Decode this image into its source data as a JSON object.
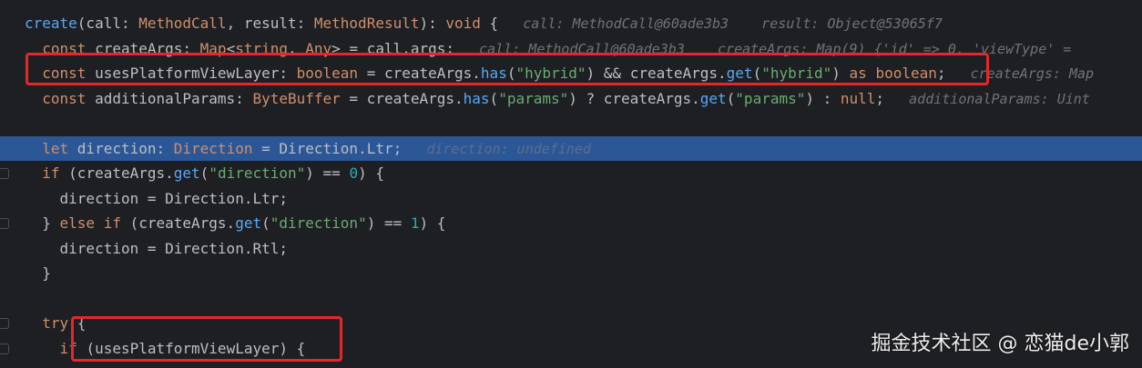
{
  "editor": {
    "lines": [
      {
        "t": [
          [
            "create",
            "fn"
          ],
          [
            "(call: ",
            "pl"
          ],
          [
            "MethodCall",
            "ty"
          ],
          [
            ", result: ",
            "pl"
          ],
          [
            "MethodResult",
            "ty"
          ],
          [
            "): ",
            "pl"
          ],
          [
            "void",
            "kw"
          ],
          [
            " {",
            "pl"
          ],
          [
            "   call: MethodCall@60ade3b3    result: Object@53065f7",
            "hint"
          ]
        ]
      },
      {
        "t": [
          [
            "  const ",
            "kw"
          ],
          [
            "createArgs: ",
            "pl"
          ],
          [
            "Map",
            "ty"
          ],
          [
            "<",
            "pl"
          ],
          [
            "string",
            "kw"
          ],
          [
            ", ",
            "pl"
          ],
          [
            "Any",
            "ty"
          ],
          [
            "> = call.args;",
            "pl"
          ],
          [
            "   call: MethodCall@60ade3b3    createArgs: Map(9) {'id' => 0, 'viewType' =",
            "hint"
          ]
        ]
      },
      {
        "t": [
          [
            "  const ",
            "kw"
          ],
          [
            "usesPlatformViewLayer: ",
            "pl"
          ],
          [
            "boolean",
            "kw"
          ],
          [
            " = createArgs.",
            "pl"
          ],
          [
            "has",
            "fn"
          ],
          [
            "(",
            "pl"
          ],
          [
            "\"hybrid\"",
            "str"
          ],
          [
            ") && createArgs.",
            "pl"
          ],
          [
            "get",
            "fn"
          ],
          [
            "(",
            "pl"
          ],
          [
            "\"hybrid\"",
            "str"
          ],
          [
            ") ",
            "pl"
          ],
          [
            "as",
            "kw"
          ],
          [
            " ",
            "pl"
          ],
          [
            "boolean",
            "kw"
          ],
          [
            ";",
            "pl"
          ],
          [
            "   createArgs: Map",
            "hint"
          ]
        ]
      },
      {
        "t": [
          [
            "  const ",
            "kw"
          ],
          [
            "additionalParams: ",
            "pl"
          ],
          [
            "ByteBuffer",
            "ty"
          ],
          [
            " = createArgs.",
            "pl"
          ],
          [
            "has",
            "fn"
          ],
          [
            "(",
            "pl"
          ],
          [
            "\"params\"",
            "str"
          ],
          [
            ") ? createArgs.",
            "pl"
          ],
          [
            "get",
            "fn"
          ],
          [
            "(",
            "pl"
          ],
          [
            "\"params\"",
            "str"
          ],
          [
            ") : ",
            "pl"
          ],
          [
            "null",
            "kw"
          ],
          [
            ";",
            "pl"
          ],
          [
            "   additionalParams: Uint",
            "hint"
          ]
        ]
      },
      {
        "t": []
      },
      {
        "current": true,
        "t": [
          [
            "  let ",
            "kw"
          ],
          [
            "direction: ",
            "pl"
          ],
          [
            "Direction",
            "ty"
          ],
          [
            " = Direction.Ltr;",
            "pl"
          ],
          [
            "   direction: undefined",
            "hint-cur"
          ]
        ]
      },
      {
        "t": [
          [
            "  if ",
            "kw"
          ],
          [
            "(createArgs.",
            "pl"
          ],
          [
            "get",
            "fn"
          ],
          [
            "(",
            "pl"
          ],
          [
            "\"direction\"",
            "str"
          ],
          [
            ") == ",
            "pl"
          ],
          [
            "0",
            "num"
          ],
          [
            ") {",
            "pl"
          ]
        ]
      },
      {
        "t": [
          [
            "    direction = Direction.Ltr;",
            "pl"
          ]
        ]
      },
      {
        "t": [
          [
            "  } ",
            "pl"
          ],
          [
            "else if ",
            "kw"
          ],
          [
            "(createArgs.",
            "pl"
          ],
          [
            "get",
            "fn"
          ],
          [
            "(",
            "pl"
          ],
          [
            "\"direction\"",
            "str"
          ],
          [
            ") == ",
            "pl"
          ],
          [
            "1",
            "num"
          ],
          [
            ") {",
            "pl"
          ]
        ]
      },
      {
        "t": [
          [
            "    direction = Direction.Rtl;",
            "pl"
          ]
        ]
      },
      {
        "t": [
          [
            "  }",
            "pl"
          ]
        ]
      },
      {
        "t": []
      },
      {
        "t": [
          [
            "  try ",
            "kw"
          ],
          [
            "{",
            "pl"
          ]
        ]
      },
      {
        "t": [
          [
            "    if ",
            "kw"
          ],
          [
            "(usesPlatformViewLayer) {",
            "pl"
          ]
        ]
      }
    ]
  },
  "watermark": "掘金技术社区 @ 恋猫de小郭",
  "colors": {
    "background": "#1e1f22",
    "highlight": "#2b5797",
    "annotation_box": "#e6262a",
    "keyword": "#cf8e6d",
    "function": "#56a8f5",
    "string": "#6aab73",
    "number": "#2aacb8"
  },
  "icons": [
    "fold-marker-icon"
  ]
}
